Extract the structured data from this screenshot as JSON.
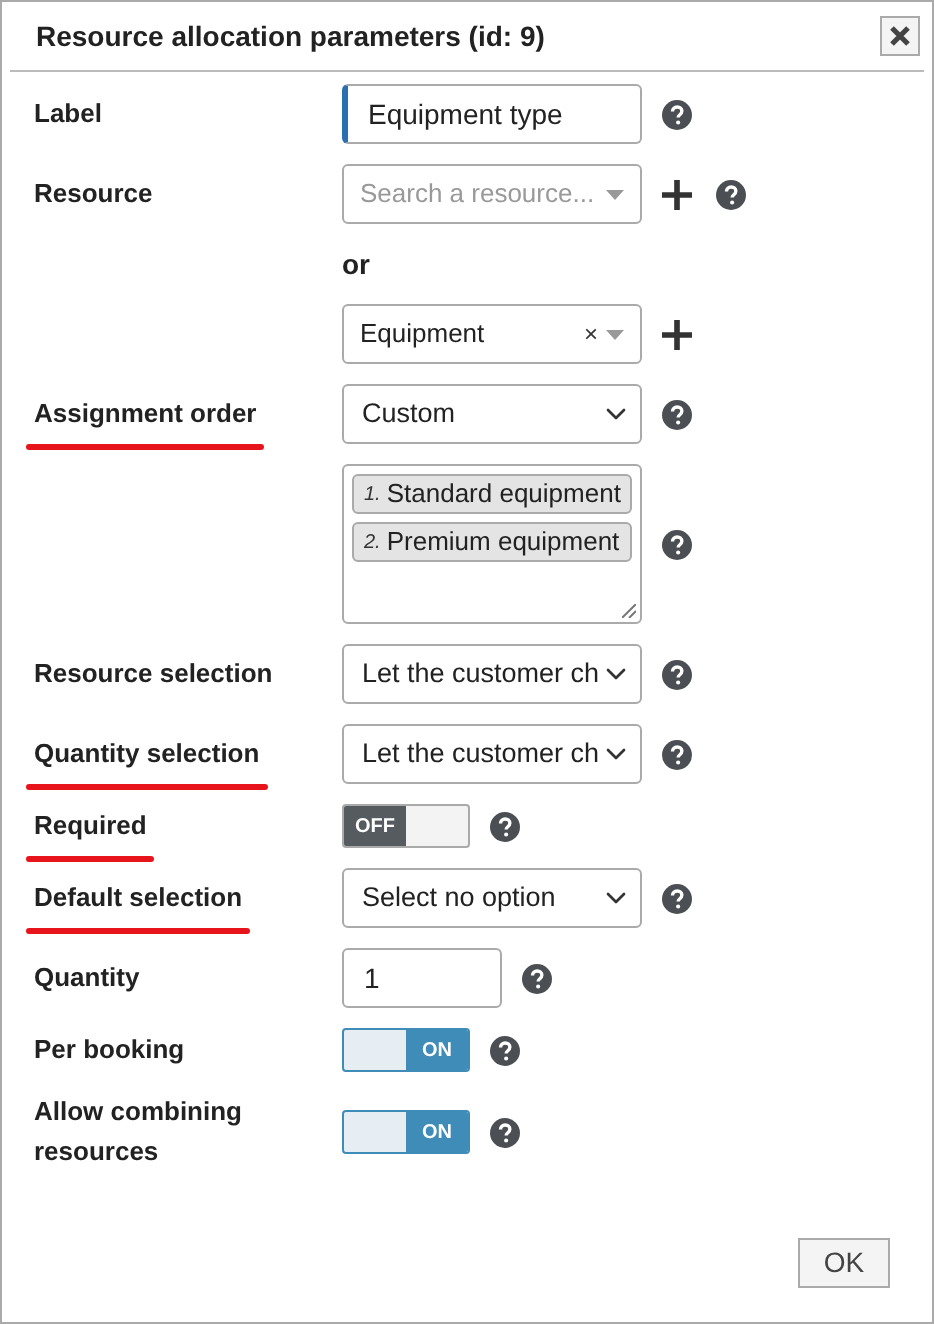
{
  "window": {
    "title": "Resource allocation parameters (id: 9)"
  },
  "rows": [
    {
      "kind": "text",
      "label": "Label",
      "value": "Equipment type",
      "focused": true,
      "underlined": false,
      "help": true
    },
    {
      "kind": "search",
      "label": "Resource",
      "placeholder": "Search a resource...",
      "add": true,
      "underlined": false,
      "help": true
    },
    {
      "kind": "separator",
      "text": "or"
    },
    {
      "kind": "tag-select",
      "value": "Equipment",
      "clear": "×",
      "add": true,
      "help": false
    },
    {
      "kind": "select",
      "label": "Assignment order",
      "value": "Custom",
      "underlined": true,
      "help": true
    },
    {
      "kind": "order-list",
      "items": [
        {
          "number": "1.",
          "label": "Standard equipment"
        },
        {
          "number": "2.",
          "label": "Premium equipment"
        }
      ],
      "help": true
    },
    {
      "kind": "select",
      "label": "Resource selection",
      "value": "Let the customer ch",
      "underlined": false,
      "help": true
    },
    {
      "kind": "select",
      "label": "Quantity selection",
      "value": "Let the customer ch",
      "underlined": true,
      "help": true
    },
    {
      "kind": "toggle",
      "label": "Required",
      "on": false,
      "text": "OFF",
      "underlined": true,
      "help": true
    },
    {
      "kind": "select",
      "label": "Default selection",
      "value": "Select no option",
      "underlined": true,
      "help": true
    },
    {
      "kind": "number",
      "label": "Quantity",
      "value": "1",
      "underlined": false,
      "help": true
    },
    {
      "kind": "toggle",
      "label": "Per booking",
      "on": true,
      "text": "ON",
      "underlined": false,
      "help": true
    },
    {
      "kind": "toggle",
      "label": "Allow combining resources",
      "on": true,
      "text": "ON",
      "underlined": false,
      "help": true
    }
  ],
  "ok_button": "OK"
}
